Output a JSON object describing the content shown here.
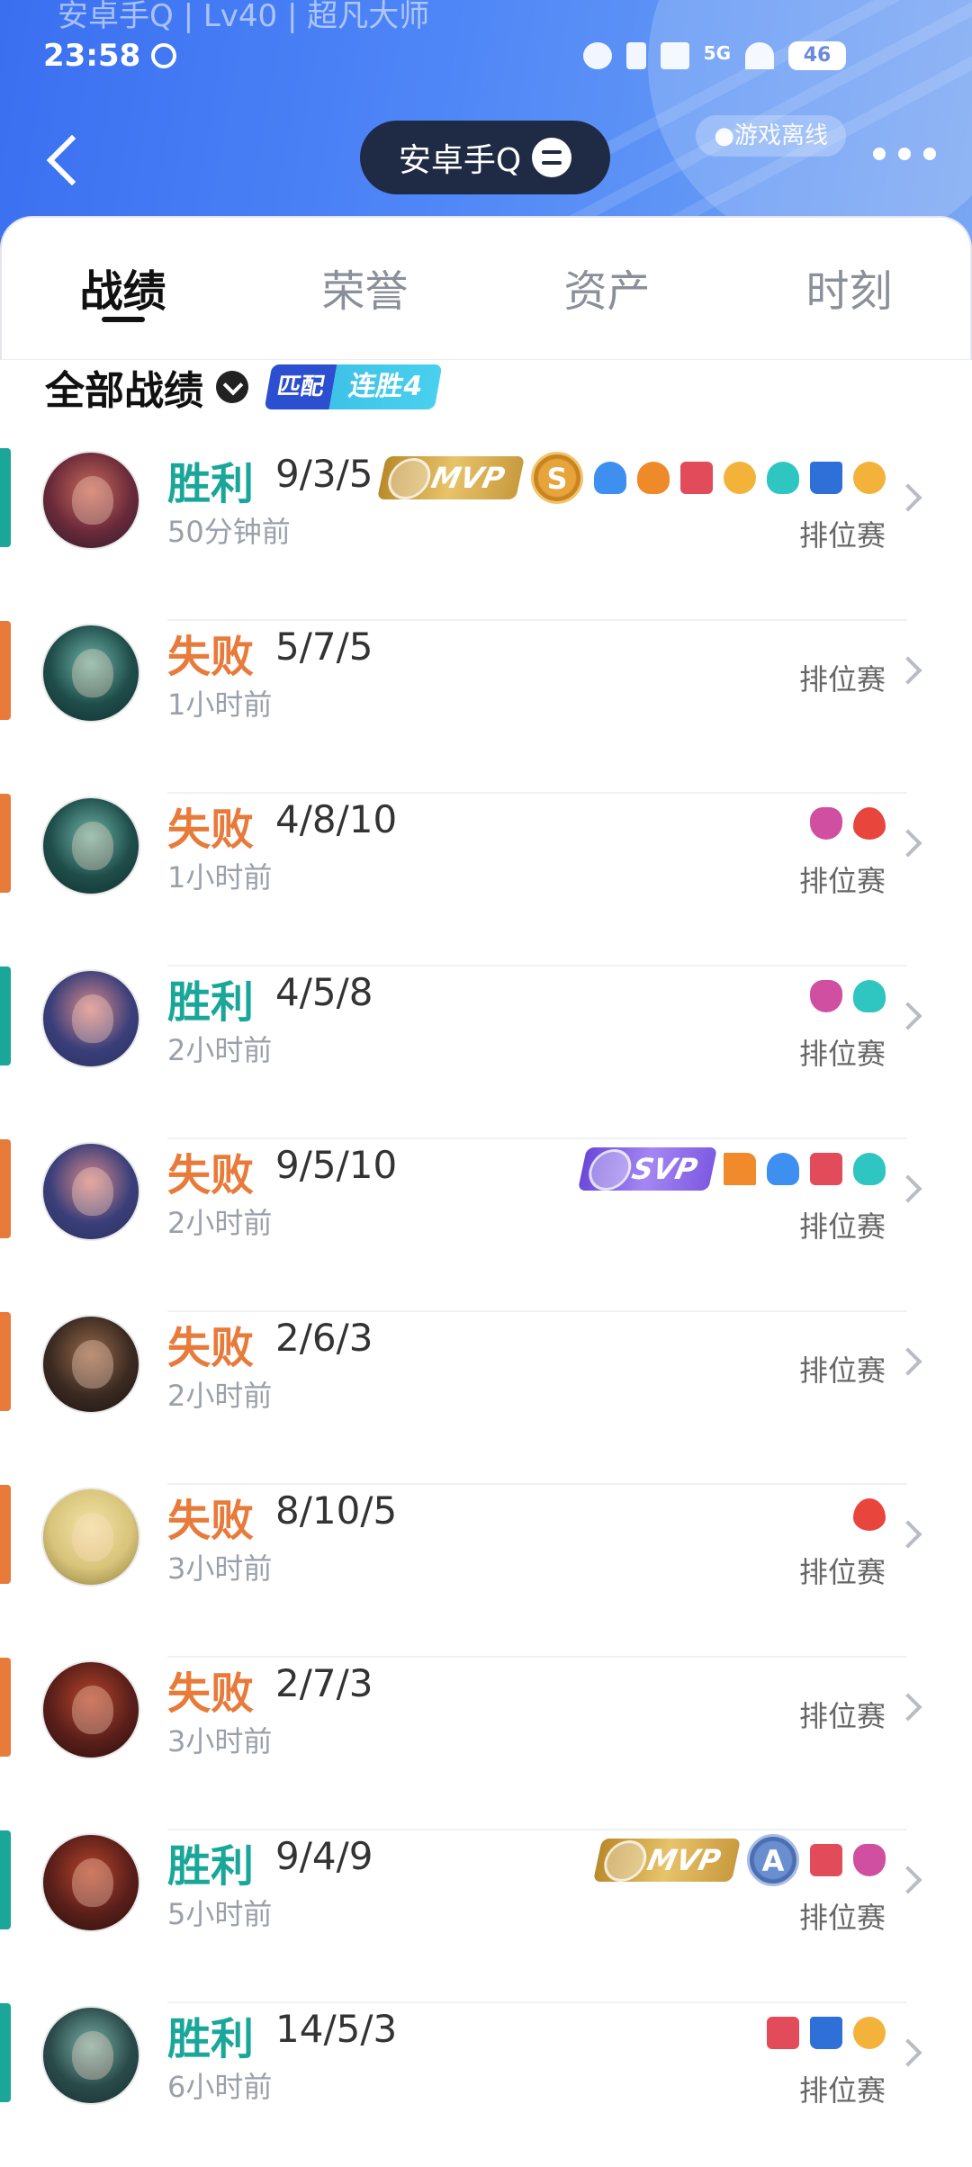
{
  "status_bar": {
    "profile_line": "安卓手Q | Lv40 | 超凡大师",
    "time": "23:58",
    "network": "5G",
    "battery": "46"
  },
  "header": {
    "title": "安卓手Q",
    "offline": "●游戏离线"
  },
  "tabs": [
    {
      "label": "战绩",
      "active": true
    },
    {
      "label": "荣誉",
      "active": false
    },
    {
      "label": "资产",
      "active": false
    },
    {
      "label": "时刻",
      "active": false
    }
  ],
  "filter": {
    "label": "全部战绩",
    "streak_mode": "匹配",
    "streak_text": "连胜4"
  },
  "colors": {
    "win": "#1aa79a",
    "loss": "#e87a3a",
    "header_blue": "#4a7ff2"
  },
  "matches": [
    {
      "result": "胜利",
      "kda": "9/3/5",
      "time": "50分钟前",
      "mode": "排位赛",
      "win": true,
      "badges": [
        "MVP",
        "S",
        "blue-flame",
        "fire",
        "red-shield",
        "gold-coins",
        "teal-heart",
        "blue-tower",
        "gold-up"
      ]
    },
    {
      "result": "失败",
      "kda": "5/7/5",
      "time": "1小时前",
      "mode": "排位赛",
      "win": false,
      "badges": []
    },
    {
      "result": "失败",
      "kda": "4/8/10",
      "time": "1小时前",
      "mode": "排位赛",
      "win": false,
      "badges": [
        "purple-demon",
        "red-drop"
      ]
    },
    {
      "result": "胜利",
      "kda": "4/5/8",
      "time": "2小时前",
      "mode": "排位赛",
      "win": true,
      "badges": [
        "purple-demon",
        "teal-heart"
      ]
    },
    {
      "result": "失败",
      "kda": "9/5/10",
      "time": "2小时前",
      "mode": "排位赛",
      "win": false,
      "badges": [
        "SVP",
        "orange-flag",
        "blue-flame",
        "red-shield",
        "teal-heart"
      ]
    },
    {
      "result": "失败",
      "kda": "2/6/3",
      "time": "2小时前",
      "mode": "排位赛",
      "win": false,
      "badges": []
    },
    {
      "result": "失败",
      "kda": "8/10/5",
      "time": "3小时前",
      "mode": "排位赛",
      "win": false,
      "badges": [
        "red-drop"
      ]
    },
    {
      "result": "失败",
      "kda": "2/7/3",
      "time": "3小时前",
      "mode": "排位赛",
      "win": false,
      "badges": []
    },
    {
      "result": "胜利",
      "kda": "9/4/9",
      "time": "5小时前",
      "mode": "排位赛",
      "win": true,
      "badges": [
        "MVP",
        "A",
        "red-shield",
        "purple-demon"
      ]
    },
    {
      "result": "胜利",
      "kda": "14/5/3",
      "time": "6小时前",
      "mode": "排位赛",
      "win": true,
      "badges": [
        "red-shield",
        "blue-tower",
        "gold-up"
      ]
    }
  ]
}
